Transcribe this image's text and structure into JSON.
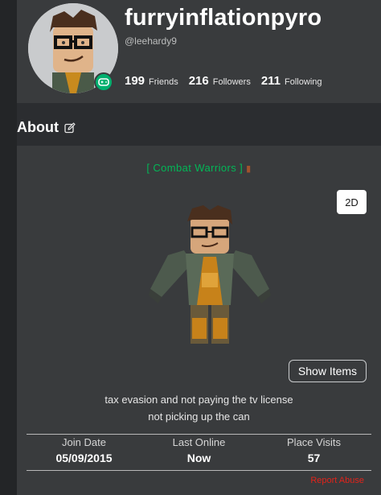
{
  "profile": {
    "display_name": "furryinflationpyro",
    "username": "@leehardy9",
    "stats": [
      {
        "value": "199",
        "label": "Friends"
      },
      {
        "value": "216",
        "label": "Followers"
      },
      {
        "value": "211",
        "label": "Following"
      }
    ],
    "presence": "in-game"
  },
  "about": {
    "title": "About",
    "status_text": "[ Combat Warriors ]",
    "view_toggle": "2D",
    "show_items": "Show Items",
    "blurb_lines": [
      "tax evasion and not paying the tv license",
      "not picking up the can"
    ],
    "info": [
      {
        "label": "Join Date",
        "value": "05/09/2015"
      },
      {
        "label": "Last Online",
        "value": "Now"
      },
      {
        "label": "Place Visits",
        "value": "57"
      }
    ],
    "report": "Report Abuse"
  },
  "colors": {
    "background": "#2b2d30",
    "card": "#393b3d",
    "online_green": "#00b06f",
    "status_green": "#02b757",
    "report_red": "#e2231a"
  }
}
